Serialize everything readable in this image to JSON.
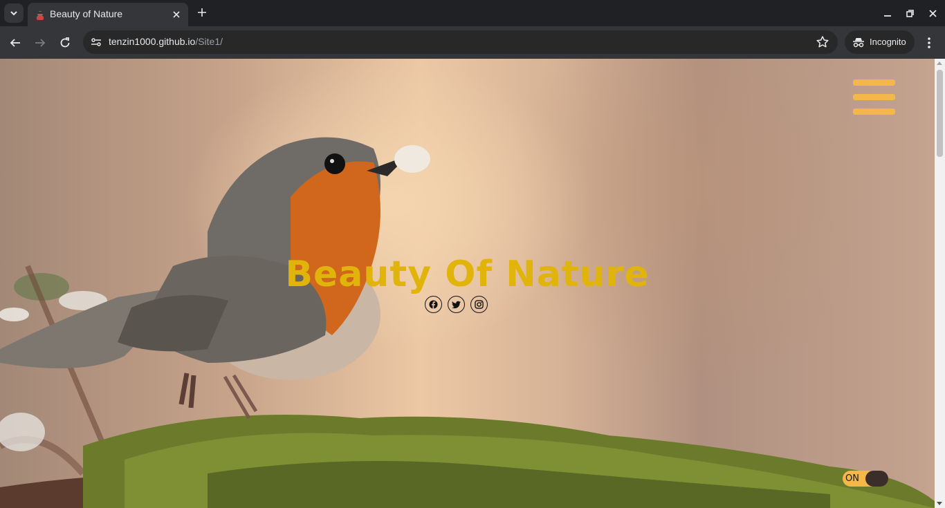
{
  "browser": {
    "tab": {
      "title": "Beauty of Nature",
      "close_icon": "close-icon"
    },
    "new_tab_icon": "plus-icon",
    "url_host": "tenzin1000.github.io",
    "url_path": "/Site1/",
    "incognito_label": "Incognito",
    "colors": {
      "frame": "#202124",
      "toolbar": "#35363a",
      "omnibox": "#282828",
      "text": "#e8eaed"
    }
  },
  "page": {
    "title": "Beauty Of Nature",
    "socials": [
      "facebook-icon",
      "twitter-icon",
      "instagram-icon"
    ],
    "toggle_label": "ON",
    "colors": {
      "title": "#e1b40b",
      "accent": "#f4b74a",
      "knob": "#3b2d2a"
    }
  }
}
